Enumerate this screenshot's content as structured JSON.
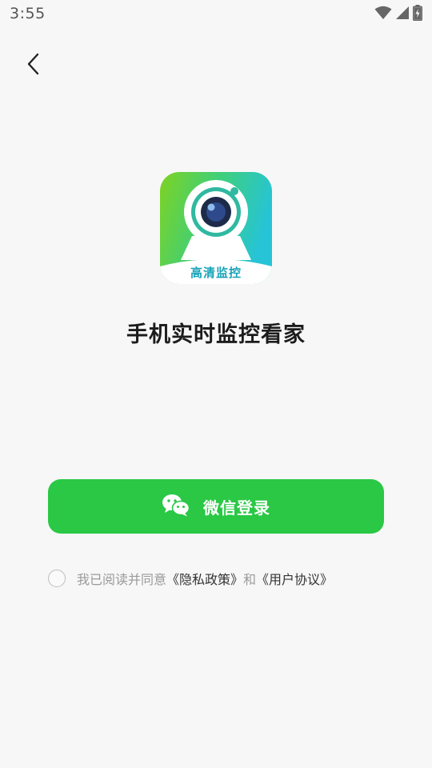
{
  "status_bar": {
    "time": "3:55",
    "icons": [
      "wifi-icon",
      "cell-signal-icon",
      "battery-charging-icon"
    ]
  },
  "nav": {
    "back_icon": "chevron-left-icon"
  },
  "app": {
    "logo_icon": "webcam-icon",
    "logo_text": "高清监控",
    "slogan": "手机实时监控看家"
  },
  "login": {
    "wechat_icon": "wechat-icon",
    "wechat_button_label": "微信登录",
    "accent_color": "#2ac845"
  },
  "agreement": {
    "prefix": "我已阅读并同意",
    "privacy_link": "《隐私政策》",
    "conjunction": "和",
    "terms_link": "《用户协议》",
    "checked": false
  }
}
